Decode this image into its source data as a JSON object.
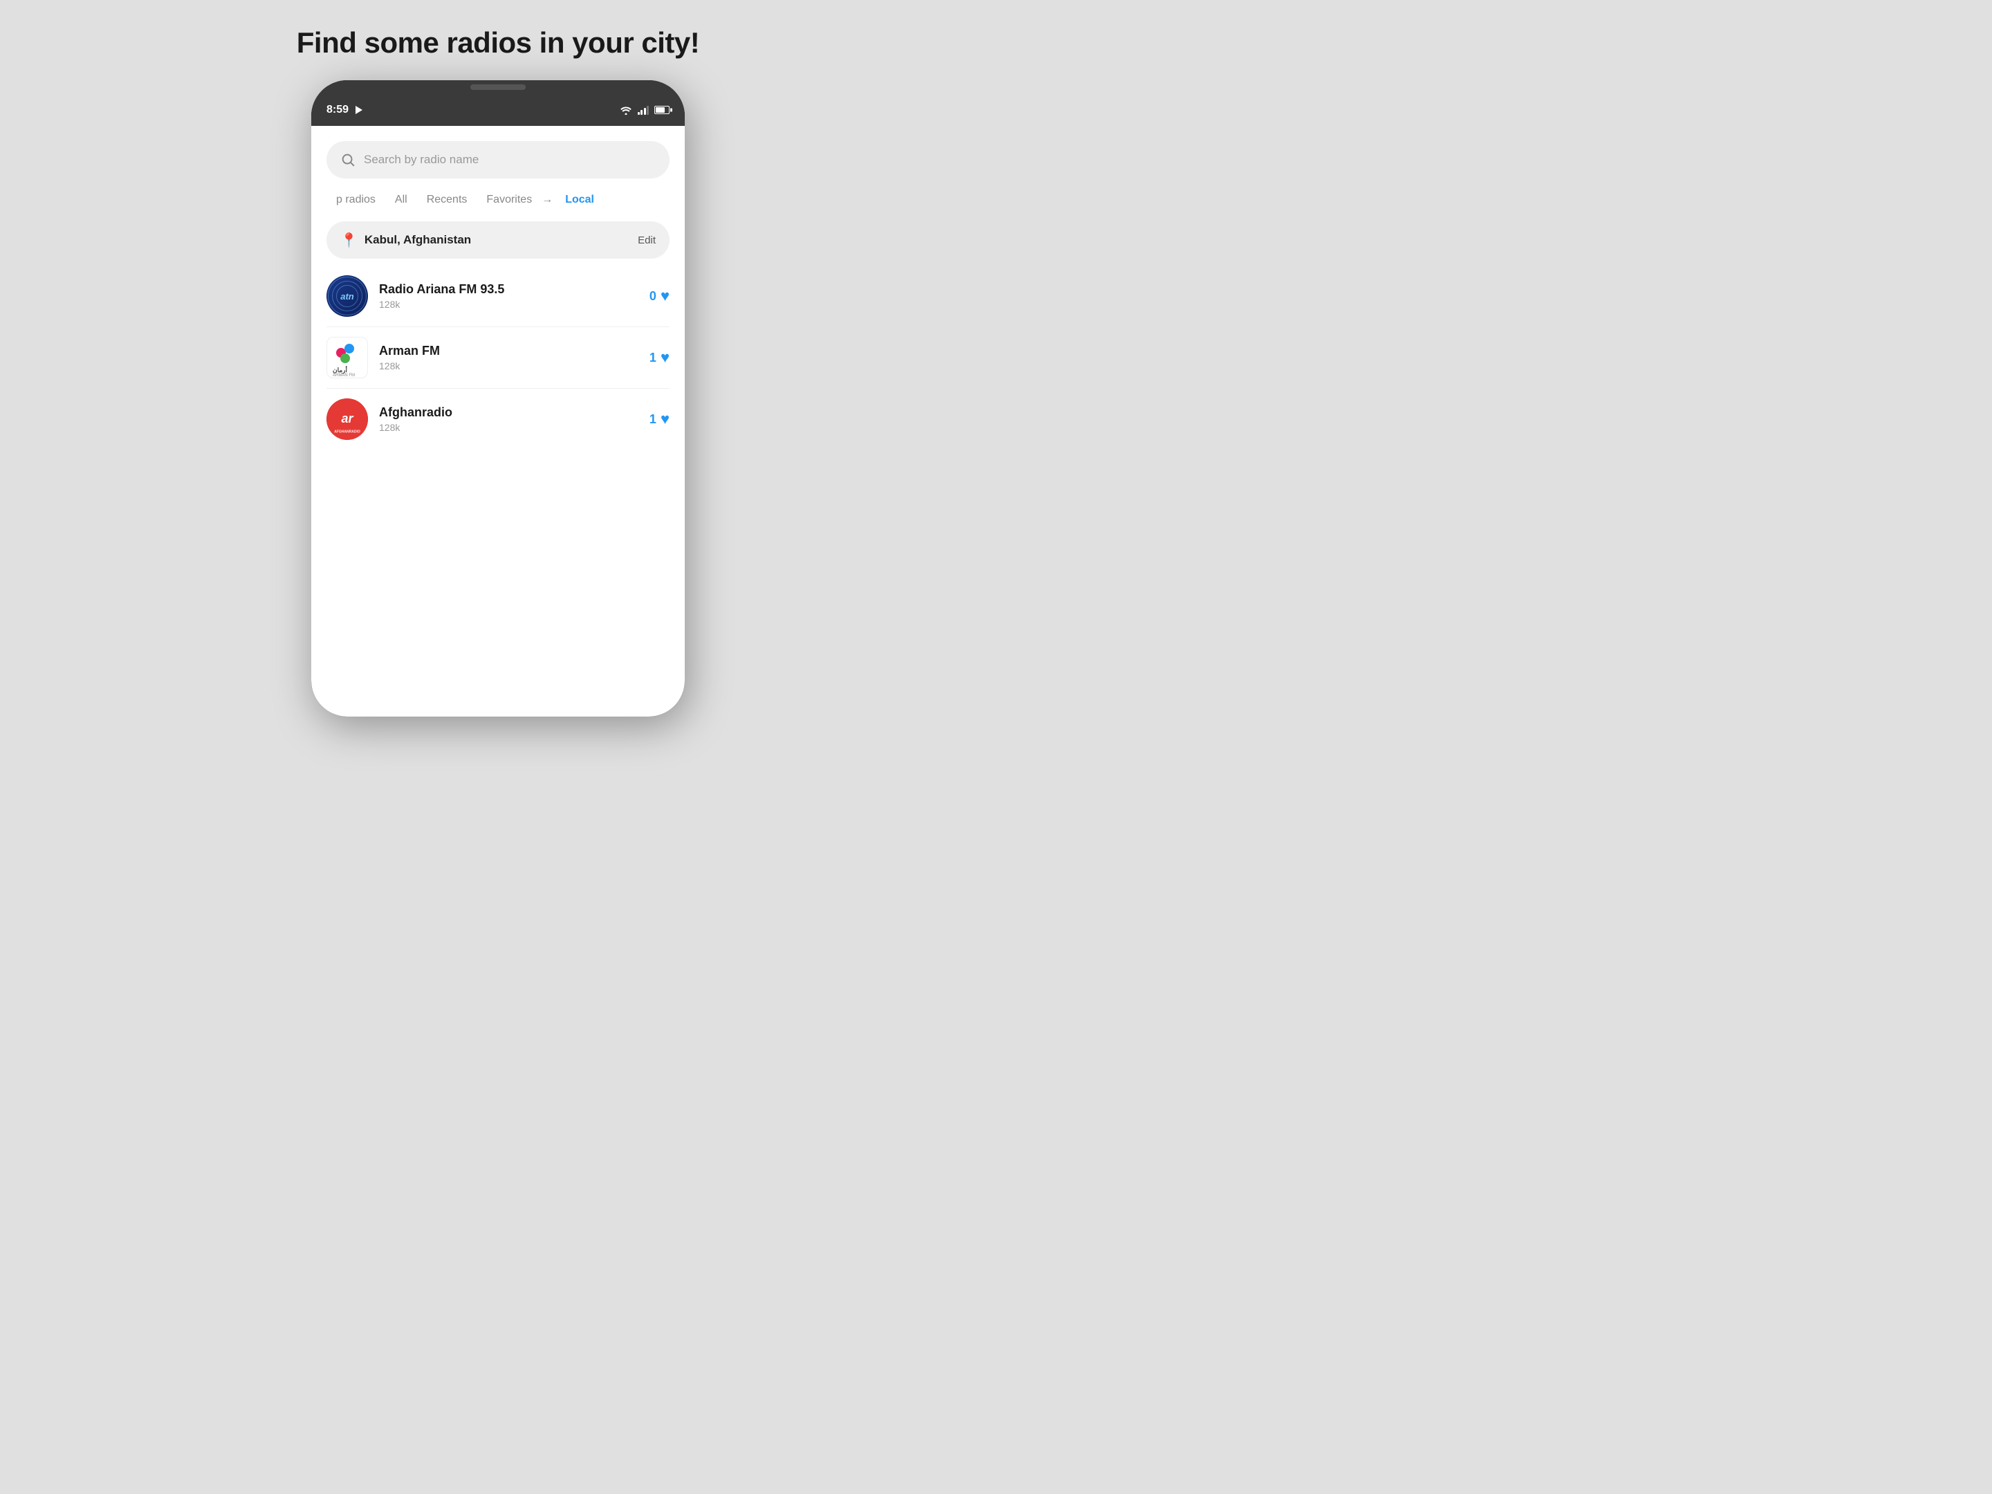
{
  "page": {
    "title": "Find some radios in your city!",
    "background_color": "#e0e0e0"
  },
  "status_bar": {
    "time": "8:59",
    "wifi": true,
    "signal": true,
    "battery": true
  },
  "search": {
    "placeholder": "Search by radio name"
  },
  "tabs": [
    {
      "label": "p radios",
      "active": false
    },
    {
      "label": "All",
      "active": false
    },
    {
      "label": "Recents",
      "active": false
    },
    {
      "label": "Favorites",
      "active": false
    },
    {
      "label": "Local",
      "active": true
    }
  ],
  "location": {
    "city": "Kabul, Afghanistan",
    "edit_label": "Edit"
  },
  "radio_list": [
    {
      "name": "Radio Ariana FM 93.5",
      "quality": "128k",
      "favorites": "0",
      "logo_type": "ariana"
    },
    {
      "name": "Arman FM",
      "quality": "128k",
      "favorites": "1",
      "logo_type": "arman"
    },
    {
      "name": "Afghanradio",
      "quality": "128k",
      "favorites": "1",
      "logo_type": "afghan"
    }
  ]
}
